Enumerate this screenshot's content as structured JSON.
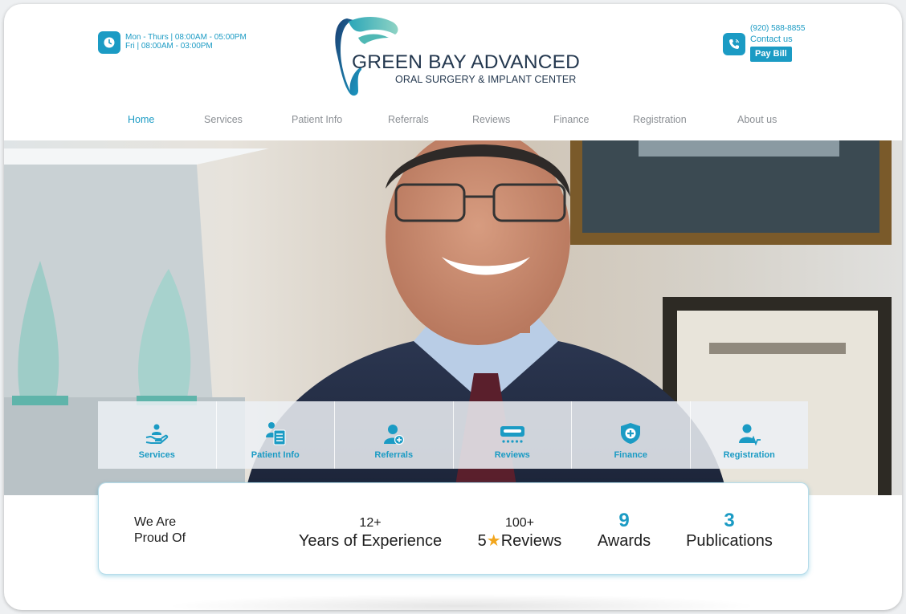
{
  "header": {
    "hours_line1": "Mon - Thurs | 08:00AM - 05:00PM",
    "hours_line2": "Fri | 08:00AM - 03:00PM",
    "logo_line1": "GREEN BAY ADVANCED",
    "logo_line2": "ORAL SURGERY & IMPLANT CENTER",
    "phone": "(920) 588-8855",
    "contact_label": "Contact us",
    "paybill_label": "Pay Bill"
  },
  "nav": {
    "items": [
      "Home",
      "Services",
      "Patient Info",
      "Referrals",
      "Reviews",
      "Finance",
      "Registration",
      "About us"
    ],
    "active": "Home"
  },
  "quick_links": [
    {
      "label": "Services",
      "icon": "hand-care-icon"
    },
    {
      "label": "Patient Info",
      "icon": "patient-document-icon"
    },
    {
      "label": "Referrals",
      "icon": "user-plus-icon"
    },
    {
      "label": "Reviews",
      "icon": "rating-card-icon"
    },
    {
      "label": "Finance",
      "icon": "shield-plus-icon"
    },
    {
      "label": "Registration",
      "icon": "user-registration-icon"
    }
  ],
  "stats": {
    "proud_line1": "We Are",
    "proud_line2": "Proud Of",
    "experience_value": "12+",
    "experience_label": "Years of Experience",
    "reviews_value": "100+",
    "reviews_prefix": "5",
    "reviews_label": "Reviews",
    "awards_value": "9",
    "awards_label": "Awards",
    "publications_value": "3",
    "publications_label": "Publications"
  },
  "colors": {
    "accent": "#1b9bc4",
    "logo_text": "#24384f",
    "nav_inactive": "#8b8f94",
    "star": "#f2a61d"
  }
}
